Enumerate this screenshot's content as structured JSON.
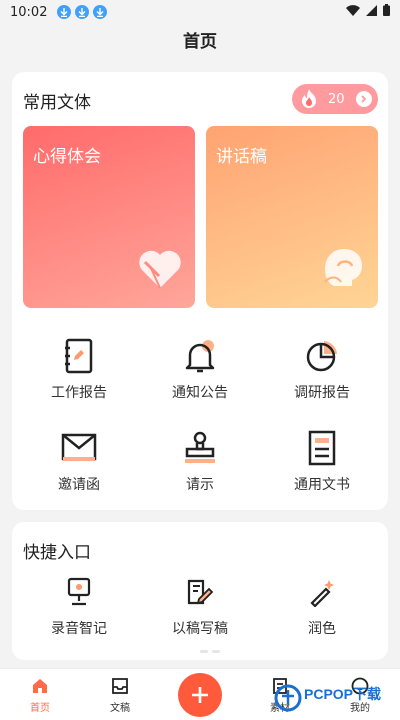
{
  "status_bar": {
    "time": "10:02",
    "download_icons": [
      "download-icon",
      "download-icon",
      "download-icon"
    ]
  },
  "header": {
    "title": "首页"
  },
  "main_card": {
    "title": "常用文体",
    "badge": {
      "count": "20"
    },
    "features": [
      {
        "label": "心得体会",
        "icon": "heart-icon"
      },
      {
        "label": "讲话稿",
        "icon": "speech-head-icon"
      }
    ],
    "grid": [
      {
        "label": "工作报告",
        "icon": "notebook-icon"
      },
      {
        "label": "通知公告",
        "icon": "bell-icon"
      },
      {
        "label": "调研报告",
        "icon": "pie-chart-icon"
      },
      {
        "label": "邀请函",
        "icon": "envelope-icon"
      },
      {
        "label": "请示",
        "icon": "stamp-icon"
      },
      {
        "label": "通用文书",
        "icon": "document-icon"
      }
    ]
  },
  "quick_card": {
    "title": "快捷入口",
    "items": [
      {
        "label": "录音智记",
        "icon": "recorder-icon"
      },
      {
        "label": "以稿写稿",
        "icon": "edit-doc-icon"
      },
      {
        "label": "润色",
        "icon": "magic-pen-icon"
      }
    ]
  },
  "bottom_nav": {
    "items": [
      {
        "label": "首页",
        "icon": "home-icon",
        "active": true
      },
      {
        "label": "文稿",
        "icon": "tray-icon"
      },
      {
        "label": "素材",
        "icon": "material-icon"
      },
      {
        "label": "我的",
        "icon": "profile-icon"
      }
    ]
  },
  "watermark": {
    "text": "PCPOP下载"
  },
  "colors": {
    "accent": "#ff5a3c",
    "badge": "#ff9a9e",
    "card_red": "#ff6b6b",
    "card_orange": "#ffa372"
  }
}
